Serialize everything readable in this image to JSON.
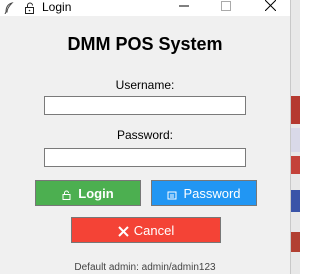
{
  "window": {
    "title": "Login"
  },
  "app": {
    "title": "DMM POS System"
  },
  "form": {
    "username_label": "Username:",
    "username_value": "",
    "password_label": "Password:",
    "password_value": ""
  },
  "buttons": {
    "login_label": "Login",
    "password_label": "Password",
    "cancel_label": "Cancel"
  },
  "footer": {
    "text": "Default admin: admin/admin123"
  },
  "colors": {
    "login": "#4caf50",
    "password": "#2196f3",
    "cancel": "#f44336"
  },
  "icons": {
    "app": "feather-icon",
    "title": "lock-icon",
    "minimize": "minimize-icon",
    "maximize": "maximize-icon",
    "close": "close-icon",
    "login": "lock-icon",
    "password": "key-icon",
    "cancel": "x-icon"
  }
}
